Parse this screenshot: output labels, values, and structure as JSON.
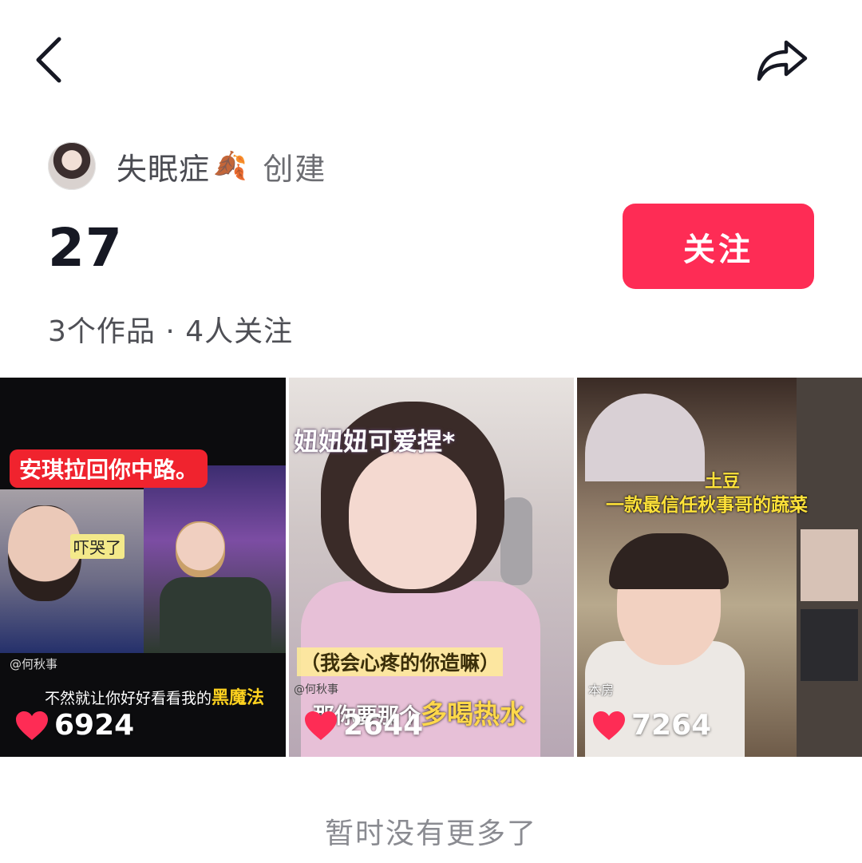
{
  "header": {
    "back_icon": "chevron-left-icon",
    "share_icon": "share-arrow-icon"
  },
  "creator": {
    "name": "失眠症",
    "emoji": "🍂",
    "action": "创建"
  },
  "collection": {
    "count": "27",
    "follow_label": "关注",
    "stats": "3个作品 · 4人关注"
  },
  "videos": [
    {
      "likes": "6924",
      "banner": "安琪拉回你中路。",
      "bubble": "吓哭了",
      "tag": "@何秋事",
      "subtitle_prefix": "不然就让你好好看看我的",
      "subtitle_highlight": "黑魔法"
    },
    {
      "likes": "2644",
      "caption_top": "妞妞妞可爱捏*",
      "caption_mid": "（我会心疼的你造嘛）",
      "tag": "@何秋事",
      "caption_bottom_prefix": "那你要那个",
      "caption_bottom_highlight": "多喝热水"
    },
    {
      "likes": "7264",
      "caption_1": "土豆",
      "caption_2": "一款最信任秋事哥的蔬菜",
      "tag": "本房"
    }
  ],
  "colors": {
    "follow_button": "#fe2c55",
    "like_heart": "#fe2c55"
  },
  "footer": {
    "no_more": "暂时没有更多了"
  }
}
